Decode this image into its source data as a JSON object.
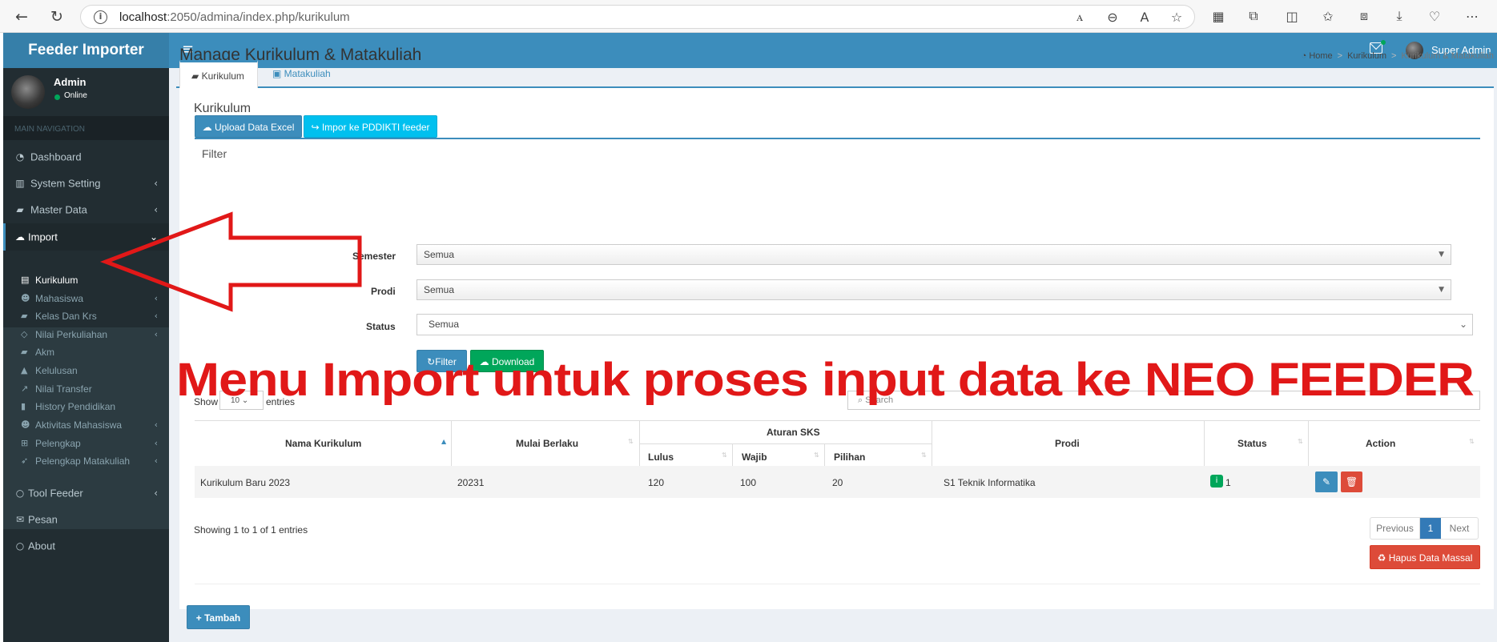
{
  "browser": {
    "url_host": "localhost",
    "url_rest": ":2050/admina/index.php/kurikulum",
    "icons": [
      "back-icon",
      "refresh-icon",
      "read-aloud-icon",
      "zoom-out-icon",
      "text-icon",
      "favorite-star-icon",
      "app-icon",
      "extensions-icon",
      "split-screen-icon",
      "favorites-icon",
      "collections-icon",
      "downloads-icon",
      "browser-essentials-icon",
      "more-icon"
    ]
  },
  "header": {
    "logo": "Feeder Importer",
    "user_name": "Super Admin"
  },
  "sidebar": {
    "user": {
      "name": "Admin",
      "status": "Online"
    },
    "section_header": "MAIN NAVIGATION",
    "items": [
      {
        "label": "Dashboard",
        "icon": "dashboard-icon"
      },
      {
        "label": "System Setting",
        "icon": "bar-chart-icon"
      },
      {
        "label": "Master Data",
        "icon": "book-icon"
      },
      {
        "label": "Import",
        "icon": "cloud-upload-icon"
      },
      {
        "label": "Tool Feeder",
        "icon": "circle-icon"
      },
      {
        "label": "Pesan",
        "icon": "envelope-icon"
      },
      {
        "label": "About",
        "icon": "circle-icon"
      }
    ],
    "submenu": [
      {
        "label": "Kurikulum",
        "icon": "suitcase-icon"
      },
      {
        "label": "Mahasiswa",
        "icon": "users-icon"
      },
      {
        "label": "Kelas Dan Krs",
        "icon": "book-icon"
      },
      {
        "label": "Nilai Perkuliahan",
        "icon": "diamond-icon"
      },
      {
        "label": "Akm",
        "icon": "book-icon"
      },
      {
        "label": "Kelulusan",
        "icon": "graduation-cap-icon"
      },
      {
        "label": "Nilai Transfer",
        "icon": "external-link-icon"
      },
      {
        "label": "History Pendidikan",
        "icon": "bookmark-icon"
      },
      {
        "label": "Aktivitas Mahasiswa",
        "icon": "users-icon"
      },
      {
        "label": "Pelengkap",
        "icon": "plus-square-icon"
      },
      {
        "label": "Pelengkap Matakuliah",
        "icon": "rocket-icon"
      }
    ]
  },
  "page": {
    "title": "Manage Kurikulum & Matakuliah",
    "breadcrumb": [
      "Home",
      "Kurikulum",
      "Kurikulum & Matakuliah"
    ],
    "tabs": [
      "Kurikulum",
      "Matakuliah"
    ],
    "section_title": "Kurikulum",
    "upload_button": "Upload Data Excel",
    "import_button": "Impor ke PDDIKTI feeder",
    "filter_title": "Filter",
    "filters": {
      "semester_label": "Semester",
      "semester_value": "Semua",
      "prodi_label": "Prodi",
      "prodi_value": "Semua",
      "status_label": "Status",
      "status_value": "Semua"
    },
    "filter_button": "Filter",
    "download_button": "Download",
    "annotation": "Menu Import untuk proses input data ke NEO FEEDER",
    "annotation_color": "#e11818",
    "length_show": "Show",
    "length_value": "10",
    "length_entries": "entries",
    "search_placeholder": "Search"
  },
  "table": {
    "headers": {
      "nama": "Nama Kurikulum",
      "mulai": "Mulai Berlaku",
      "aturan": "Aturan SKS",
      "lulus": "Lulus",
      "wajib": "Wajib",
      "pilihan": "Pilihan",
      "prodi": "Prodi",
      "status": "Status",
      "action": "Action"
    },
    "rows": [
      {
        "nama": "Kurikulum Baru 2023",
        "mulai": "20231",
        "lulus": "120",
        "wajib": "100",
        "pilihan": "20",
        "prodi": "S1 Teknik Informatika",
        "status": "1"
      }
    ],
    "info": "Showing 1 to 1 of 1 entries",
    "pagination": {
      "prev": "Previous",
      "page": "1",
      "next": "Next"
    },
    "mass_delete": "Hapus Data Massal",
    "add_button": "Tambah"
  },
  "colors": {
    "primary": "#3c8dbc",
    "info": "#00c0ef",
    "success": "#00a65a",
    "danger": "#dd4b39",
    "sidebar": "#222d32"
  }
}
